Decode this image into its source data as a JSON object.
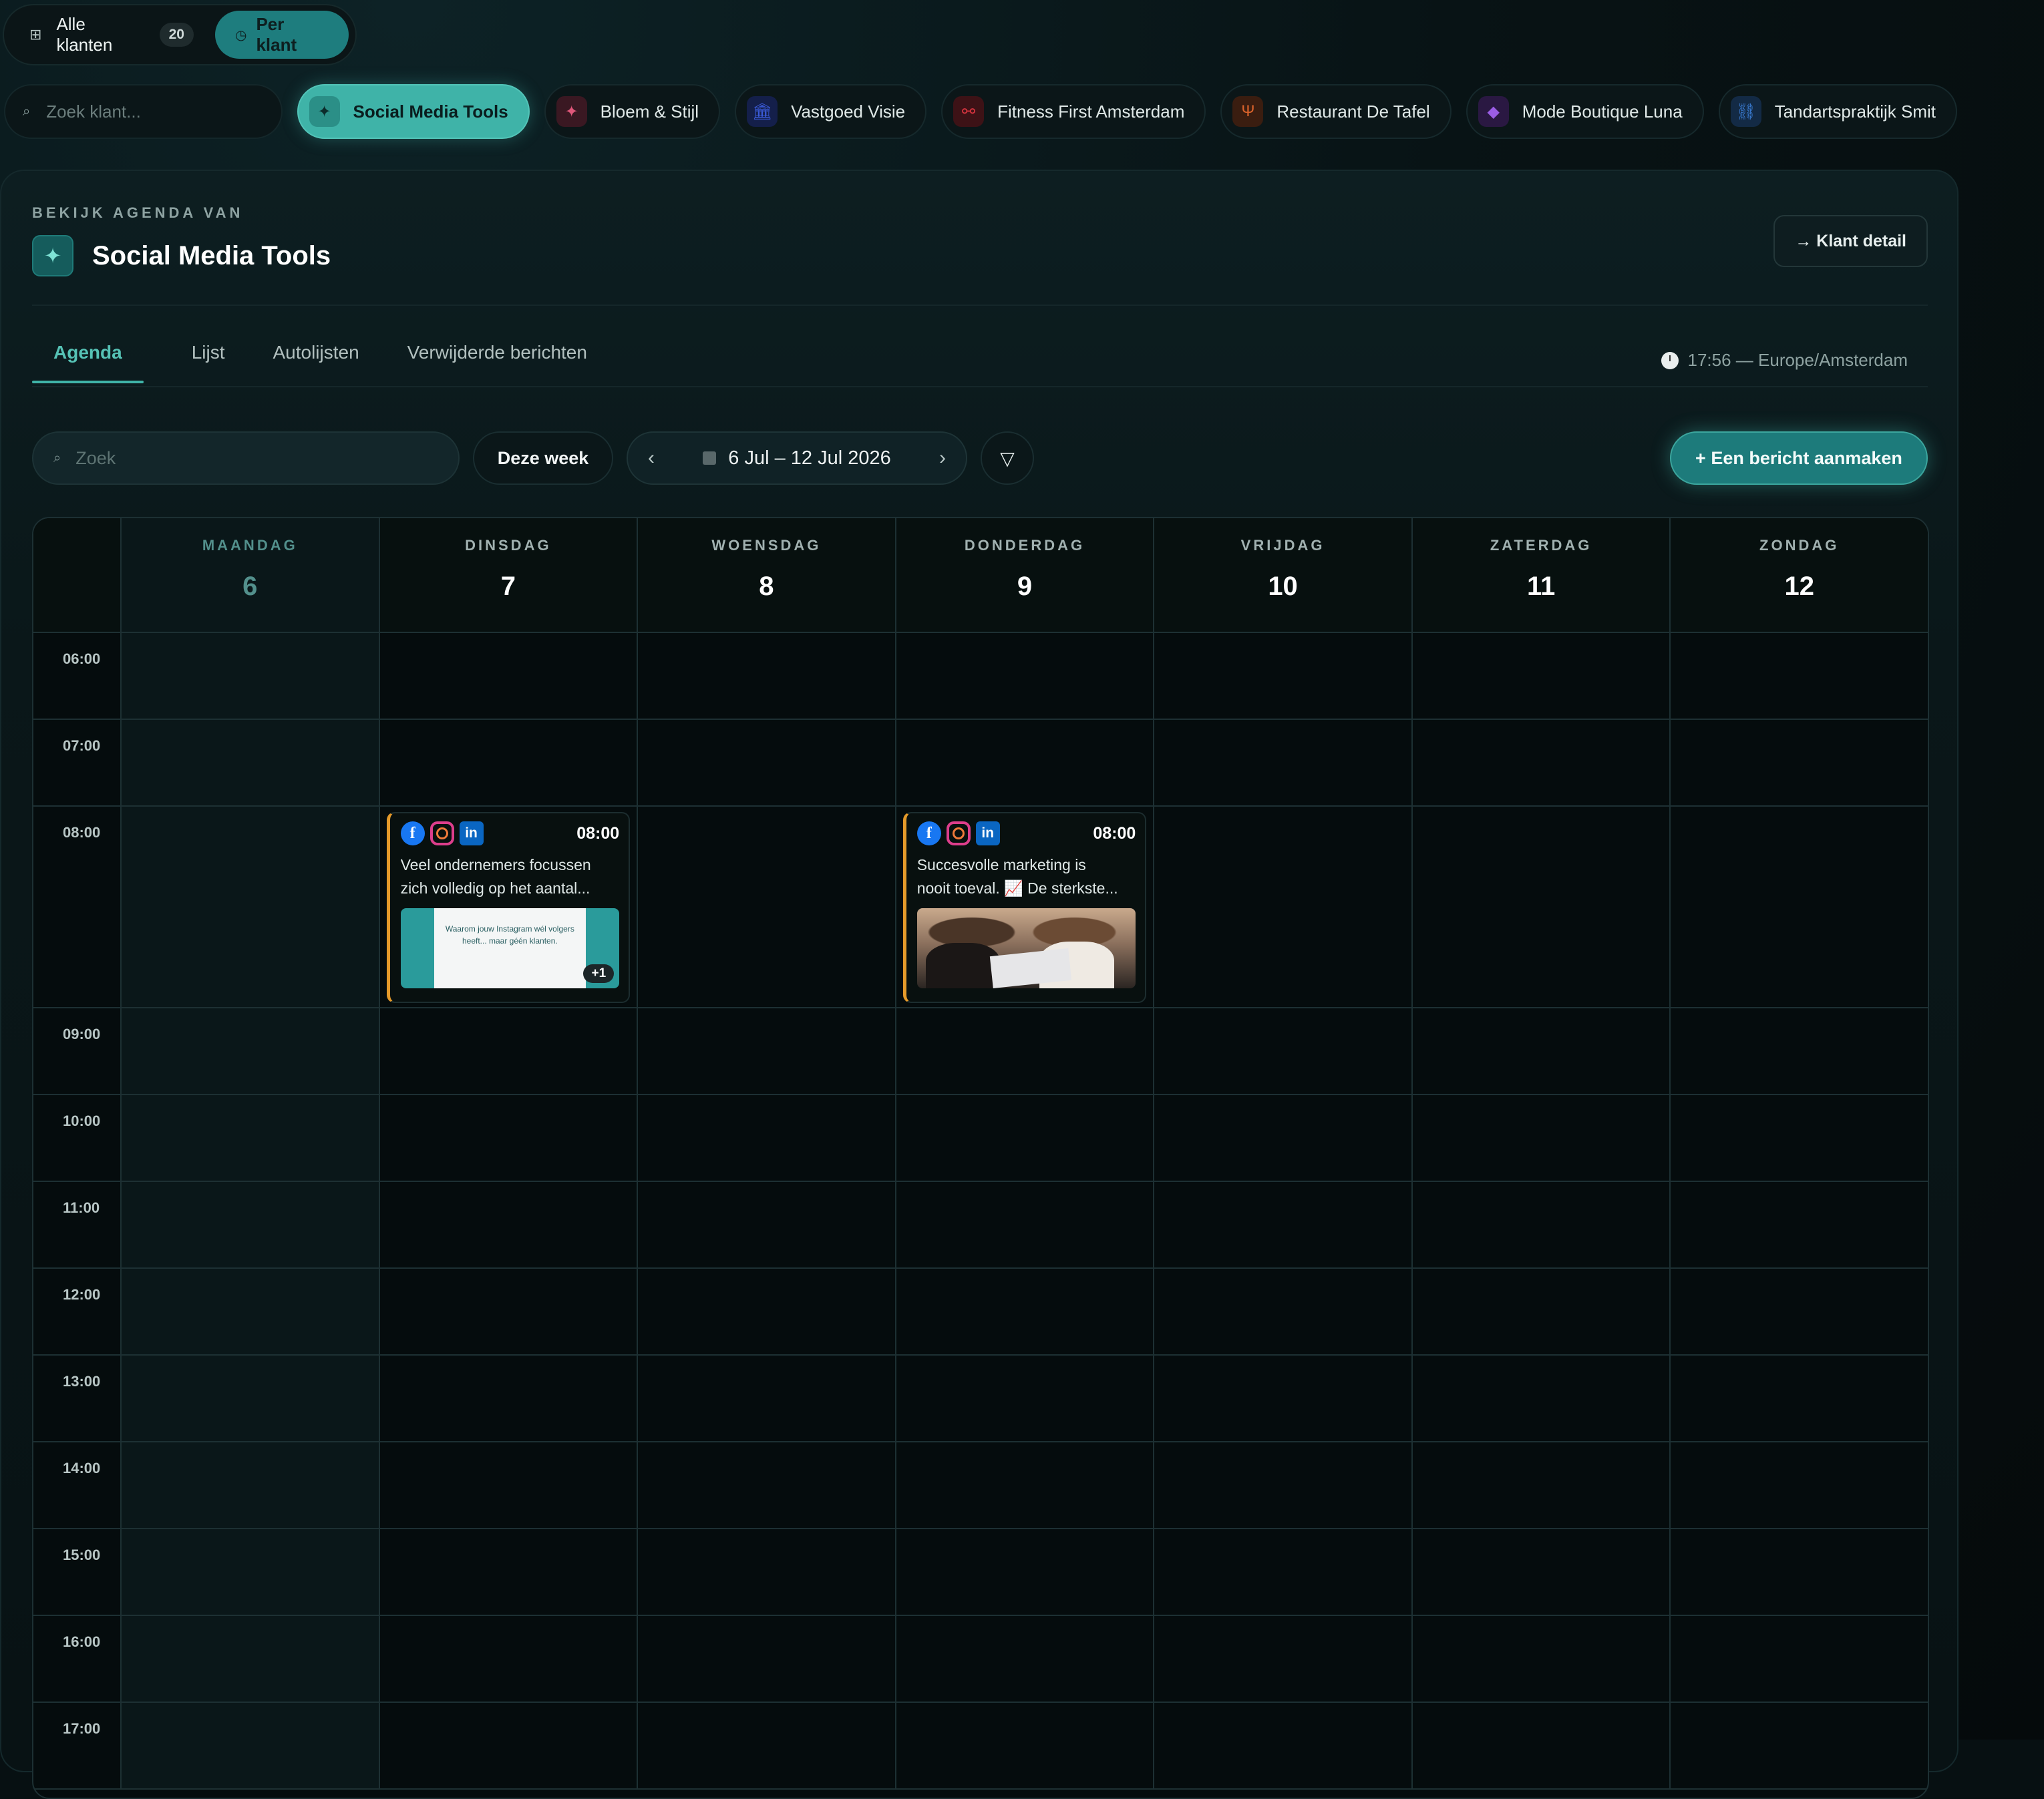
{
  "view_toggle": {
    "all_label": "Alle klanten",
    "all_count": "20",
    "per_label": "Per klant",
    "all_icon": "grid-icon",
    "per_icon": "clock-icon"
  },
  "client_search": {
    "placeholder": "Zoek klant..."
  },
  "clients": [
    {
      "name": "Social Media Tools",
      "icon": "sparkle-icon",
      "color": "#3fb3a8",
      "active": true
    },
    {
      "name": "Bloem & Stijl",
      "icon": "sparkle-icon",
      "color": "#e0577a"
    },
    {
      "name": "Vastgoed Visie",
      "icon": "building-icon",
      "color": "#3b5bd9"
    },
    {
      "name": "Fitness First Amsterdam",
      "icon": "dumbbell-icon",
      "color": "#d8343f"
    },
    {
      "name": "Restaurant De Tafel",
      "icon": "utensils-icon",
      "color": "#d9622b"
    },
    {
      "name": "Mode Boutique Luna",
      "icon": "gem-icon",
      "color": "#9b5de5"
    },
    {
      "name": "Tandartspraktijk Smit",
      "icon": "link-icon",
      "color": "#3b7fd9"
    }
  ],
  "header": {
    "eyebrow": "BEKIJK AGENDA VAN",
    "title": "Social Media Tools",
    "detail_button": "→ Klant detail"
  },
  "tabs": [
    {
      "label": "Agenda",
      "active": true
    },
    {
      "label": "Lijst"
    },
    {
      "label": "Autolijsten"
    },
    {
      "label": "Verwijderde berichten"
    }
  ],
  "timezone": "17:56 — Europe/Amsterdam",
  "toolbar": {
    "search_placeholder": "Zoek",
    "this_week": "Deze week",
    "range": "6 Jul – 12 Jul 2026",
    "prev": "‹",
    "next": "›",
    "filter": "▽",
    "create": "+ Een bericht aanmaken"
  },
  "days": [
    {
      "name": "MAANDAG",
      "num": "6",
      "today": true
    },
    {
      "name": "DINSDAG",
      "num": "7"
    },
    {
      "name": "WOENSDAG",
      "num": "8"
    },
    {
      "name": "DONDERDAG",
      "num": "9"
    },
    {
      "name": "VRIJDAG",
      "num": "10"
    },
    {
      "name": "ZATERDAG",
      "num": "11"
    },
    {
      "name": "ZONDAG",
      "num": "12"
    }
  ],
  "times": [
    "06:00",
    "07:00",
    "08:00",
    "09:00",
    "10:00",
    "11:00",
    "12:00",
    "13:00",
    "14:00",
    "15:00",
    "16:00",
    "17:00"
  ],
  "events": [
    {
      "day": "DINSDAG",
      "time": "08:00",
      "platforms": [
        "facebook",
        "instagram",
        "linkedin"
      ],
      "text1": "Veel ondernemers focussen",
      "text2": "zich volledig op het aantal...",
      "image_text": "Waarom jouw Instagram wél volgers heeft... maar géén klanten.",
      "extra_media": "+1"
    },
    {
      "day": "DONDERDAG",
      "time": "08:00",
      "platforms": [
        "facebook",
        "instagram",
        "linkedin"
      ],
      "text1": "Succesvolle marketing is",
      "text2": "nooit toeval. 📈 De sterkste..."
    }
  ]
}
